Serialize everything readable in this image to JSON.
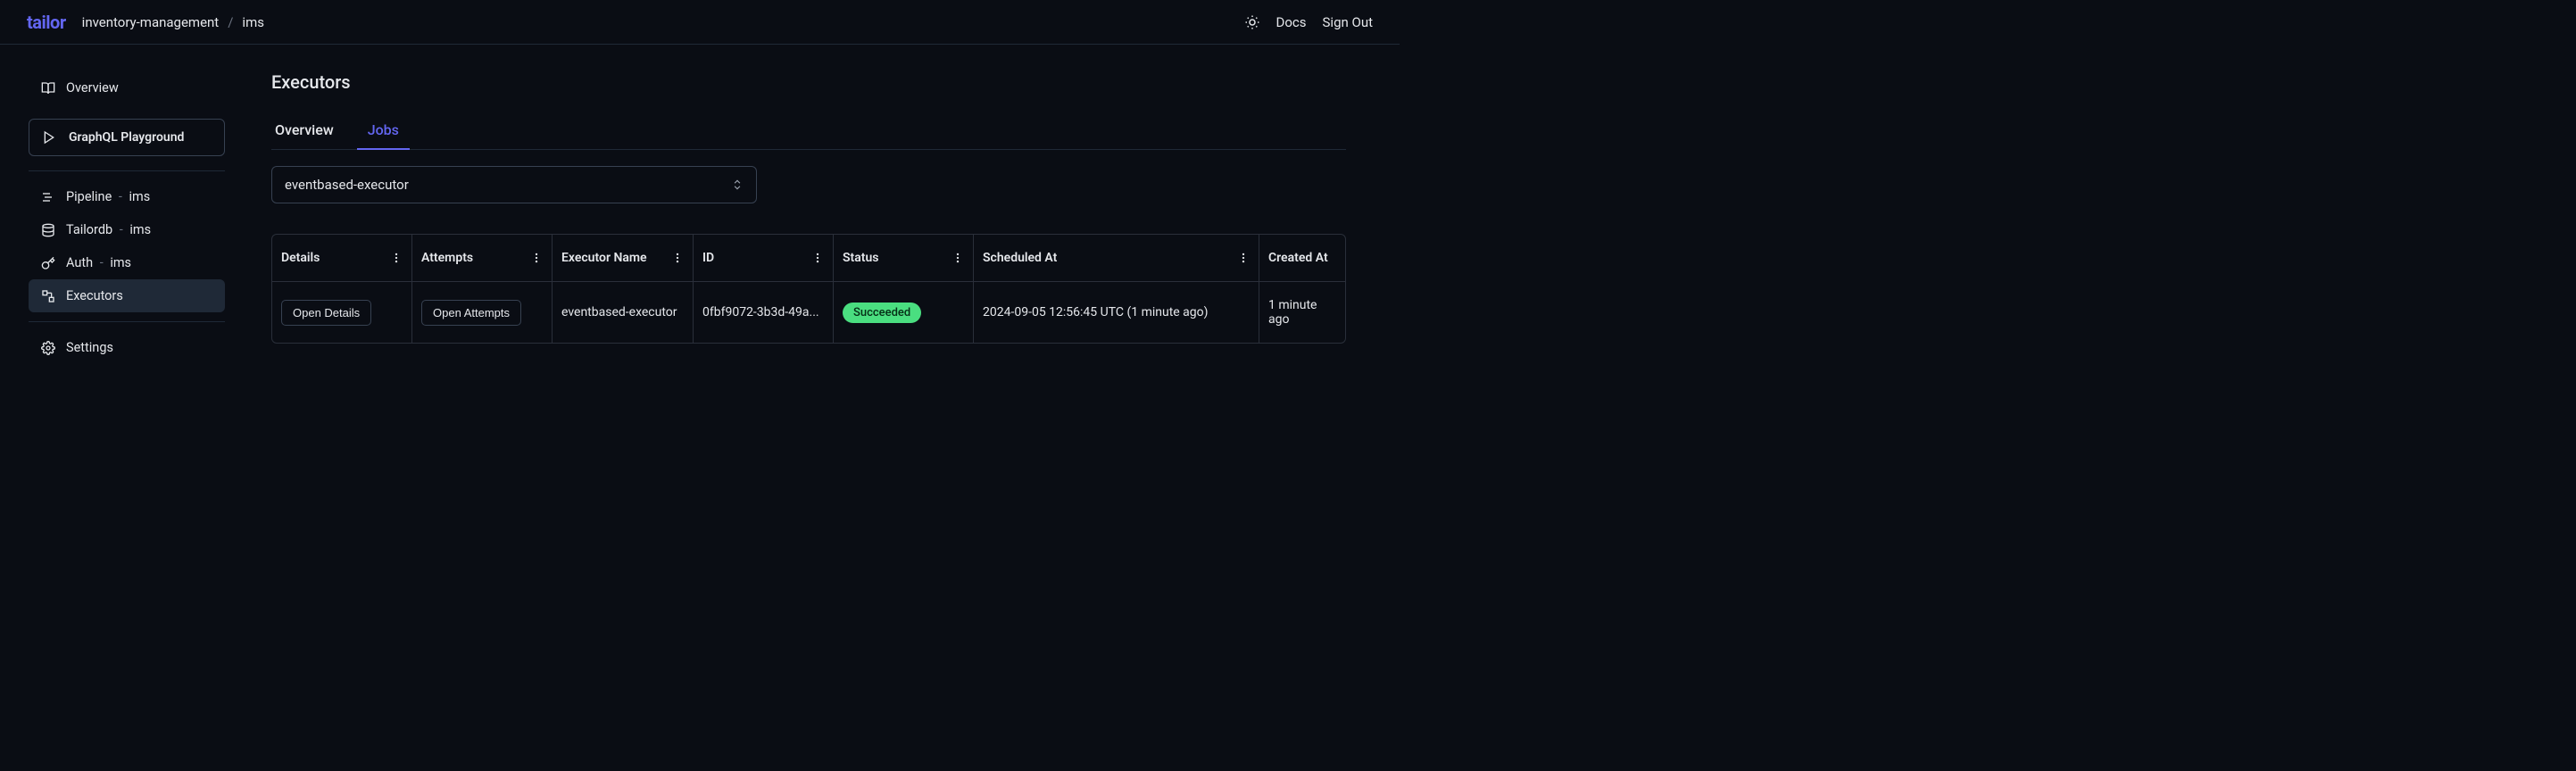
{
  "header": {
    "logo": "tailor",
    "breadcrumb": {
      "parent": "inventory-management",
      "current": "ims"
    },
    "links": {
      "docs": "Docs",
      "signout": "Sign Out"
    }
  },
  "sidebar": {
    "overview": "Overview",
    "playground": "GraphQL Playground",
    "pipeline": {
      "label": "Pipeline",
      "sub": "ims"
    },
    "tailordb": {
      "label": "Tailordb",
      "sub": "ims"
    },
    "auth": {
      "label": "Auth",
      "sub": "ims"
    },
    "executors": "Executors",
    "settings": "Settings"
  },
  "page": {
    "title": "Executors",
    "tabs": {
      "overview": "Overview",
      "jobs": "Jobs"
    },
    "selector": {
      "value": "eventbased-executor"
    },
    "table": {
      "headers": {
        "details": "Details",
        "attempts": "Attempts",
        "executor_name": "Executor Name",
        "id": "ID",
        "status": "Status",
        "scheduled_at": "Scheduled At",
        "created_at": "Created At"
      },
      "rows": [
        {
          "details_btn": "Open Details",
          "attempts_btn": "Open Attempts",
          "executor_name": "eventbased-executor",
          "id": "0fbf9072-3b3d-49a...",
          "status": "Succeeded",
          "scheduled_at": "2024-09-05 12:56:45 UTC (1 minute ago)",
          "created_at": "1 minute ago"
        }
      ]
    }
  }
}
